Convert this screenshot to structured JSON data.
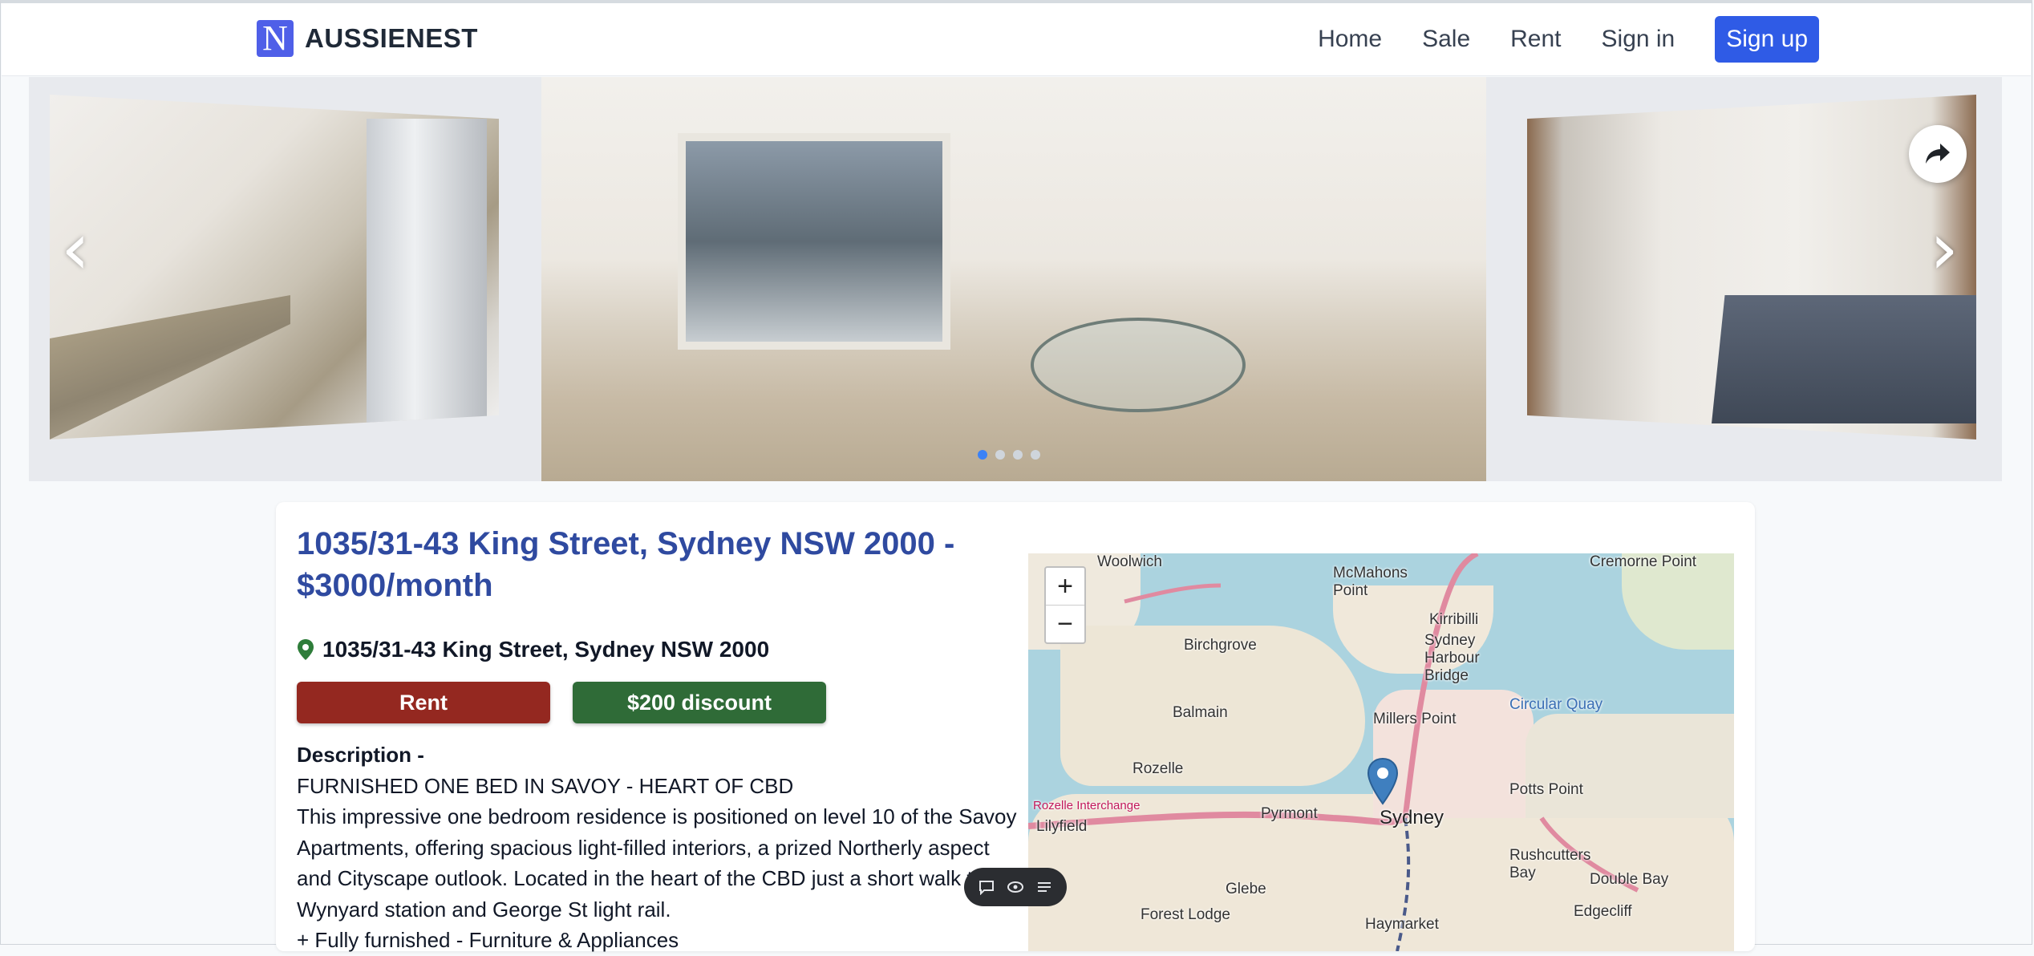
{
  "header": {
    "logo_letter": "N",
    "brand": "AUSSIENEST",
    "nav": [
      "Home",
      "Sale",
      "Rent",
      "Sign in"
    ],
    "signup": "Sign up"
  },
  "carousel": {
    "slides_total": 4,
    "active_slide": 1
  },
  "listing": {
    "title": "1035/31-43 King Street, Sydney NSW 2000 - $3000/month",
    "address": "1035/31-43 King Street, Sydney NSW 2000",
    "type_label": "Rent",
    "discount_label": "$200 discount",
    "description_label": "Description -",
    "description_lines": [
      "FURNISHED ONE BED IN SAVOY - HEART OF CBD",
      "This impressive one bedroom residence is positioned on level 10 of the Savoy Apartments, offering spacious light-filled interiors, a prized Northerly aspect and Cityscape outlook. Located in the heart of the CBD just a short walk to Wynyard station and George St light rail.",
      "+ Fully furnished - Furniture & Appliances"
    ]
  },
  "map": {
    "zoom_in": "+",
    "zoom_out": "−",
    "labels": [
      "Woolwich",
      "McMahons Point",
      "Cremorne Point",
      "Kirribilli",
      "Birchgrove",
      "Sydney Harbour Bridge",
      "Balmain",
      "Millers Point",
      "Rozelle",
      "Sydney",
      "Potts Point",
      "Lilyfield",
      "Pyrmont",
      "Rushcutters Bay",
      "Glebe",
      "Double Bay",
      "Forest Lodge",
      "Haymarket",
      "Edgecliff",
      "Circular Quay",
      "Rozelle Interchange"
    ]
  },
  "colors": {
    "brand": "#4f5fe8",
    "title": "#2f4aa0",
    "rent": "#942820",
    "discount": "#2f6b37",
    "signup": "#2f5be6"
  }
}
